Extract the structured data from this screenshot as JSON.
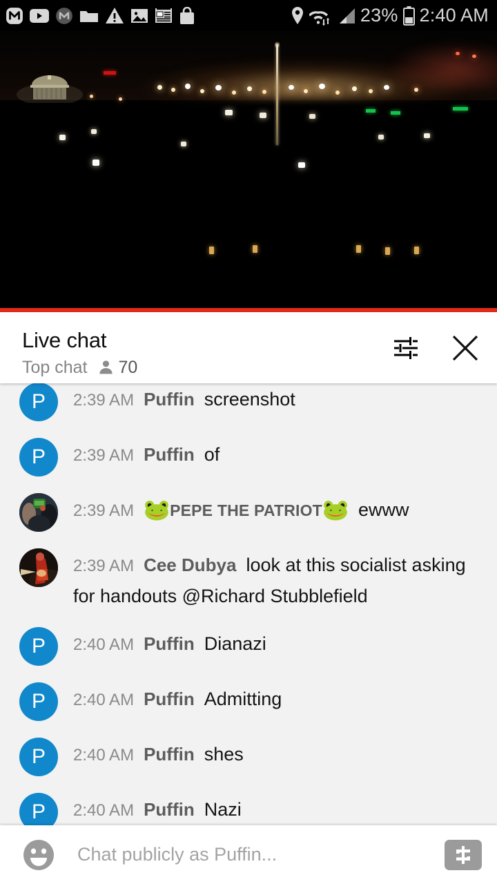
{
  "status_bar": {
    "left_icons": [
      {
        "name": "mail-app-icon",
        "glyph": "M"
      },
      {
        "name": "youtube-icon",
        "glyph": "▶"
      },
      {
        "name": "mail-circle-icon",
        "glyph": "M"
      },
      {
        "name": "folder-icon",
        "glyph": "folder"
      },
      {
        "name": "warning-triangle-icon",
        "glyph": "!"
      },
      {
        "name": "image-icon",
        "glyph": "image"
      },
      {
        "name": "news-icon",
        "glyph": "news"
      },
      {
        "name": "shopping-bag-icon",
        "glyph": "bag"
      }
    ],
    "right_icons": [
      {
        "name": "location-pin-icon"
      },
      {
        "name": "wifi-icon"
      },
      {
        "name": "cell-signal-icon"
      },
      {
        "name": "battery-icon"
      }
    ],
    "battery_percent": "23%",
    "clock": "2:40 AM"
  },
  "video": {
    "progress_color": "#e02a1a",
    "progress_percent": 100,
    "scene_description": "night cityscape"
  },
  "chat_header": {
    "title": "Live chat",
    "mode": "Top chat",
    "viewer_icon": "person-icon",
    "viewer_count": "70",
    "settings_icon": "tune-sliders-icon",
    "close_icon": "close-icon"
  },
  "messages": [
    {
      "avatar_type": "letter",
      "avatar_letter": "P",
      "avatar_color": "#1188cc",
      "time": "2:39 AM",
      "author": "Puffin",
      "text": "screenshot",
      "badge": null
    },
    {
      "avatar_type": "letter",
      "avatar_letter": "P",
      "avatar_color": "#1188cc",
      "time": "2:39 AM",
      "author": "Puffin",
      "text": "of",
      "badge": null
    },
    {
      "avatar_type": "photo1",
      "avatar_letter": "",
      "avatar_color": "#3a4a5a",
      "time": "2:39 AM",
      "author": "PEPE THE PATRIOT",
      "text": "ewww",
      "badge": "frog-emoji"
    },
    {
      "avatar_type": "photo2",
      "avatar_letter": "",
      "avatar_color": "#1b1410",
      "time": "2:39 AM",
      "author": "Cee Dubya",
      "text": "look at this socialist asking for handouts @Richard Stubblefield",
      "badge": null
    },
    {
      "avatar_type": "letter",
      "avatar_letter": "P",
      "avatar_color": "#1188cc",
      "time": "2:40 AM",
      "author": "Puffin",
      "text": "Dianazi",
      "badge": null
    },
    {
      "avatar_type": "letter",
      "avatar_letter": "P",
      "avatar_color": "#1188cc",
      "time": "2:40 AM",
      "author": "Puffin",
      "text": "Admitting",
      "badge": null
    },
    {
      "avatar_type": "letter",
      "avatar_letter": "P",
      "avatar_color": "#1188cc",
      "time": "2:40 AM",
      "author": "Puffin",
      "text": "shes",
      "badge": null
    },
    {
      "avatar_type": "letter",
      "avatar_letter": "P",
      "avatar_color": "#1188cc",
      "time": "2:40 AM",
      "author": "Puffin",
      "text": "Nazi",
      "badge": null
    }
  ],
  "input_bar": {
    "emoji_icon": "emoji-smiley-icon",
    "placeholder": "Chat publicly as Puffin...",
    "value": "",
    "superchat_icon": "dollar-icon"
  }
}
